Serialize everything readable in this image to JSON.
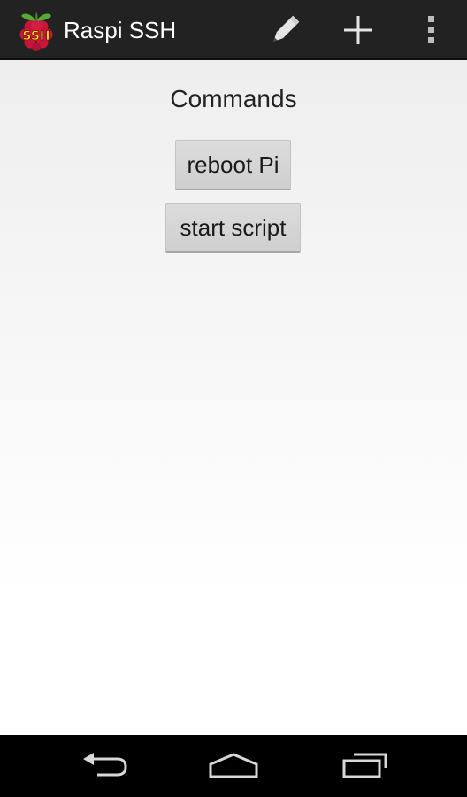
{
  "app": {
    "title": "Raspi SSH",
    "logo_text": "SSH"
  },
  "action_bar": {
    "actions": [
      {
        "icon": "pencil-icon"
      },
      {
        "icon": "plus-icon"
      },
      {
        "icon": "overflow-menu-icon"
      }
    ]
  },
  "content": {
    "title": "Commands",
    "commands": [
      {
        "label": "reboot Pi"
      },
      {
        "label": "start script"
      }
    ]
  },
  "nav_bar": {
    "buttons": [
      {
        "icon": "back-icon"
      },
      {
        "icon": "home-icon"
      },
      {
        "icon": "recent-apps-icon"
      }
    ]
  },
  "colors": {
    "action_bar": "#222222",
    "background_top": "#ececec",
    "background_bottom": "#ffffff",
    "button_face": "#d6d6d6",
    "logo_berry": "#c6163a",
    "logo_leaf": "#5aa832",
    "logo_text": "#f5e600",
    "nav_bar": "#000000"
  }
}
